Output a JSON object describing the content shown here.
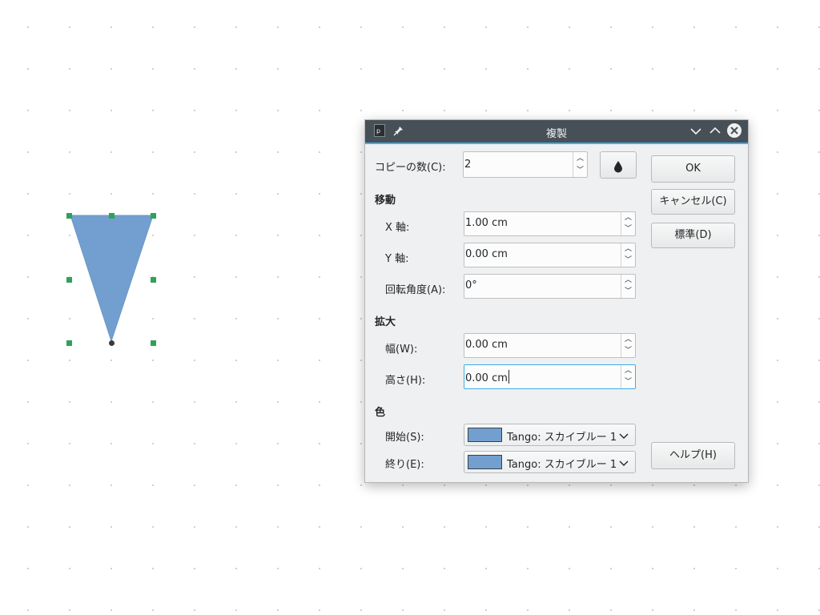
{
  "canvas": {
    "shape_fill": "#729fcf",
    "handle_color": "#2fa25a"
  },
  "dialog": {
    "title": "複製",
    "copies": {
      "label": "コピーの数(C):",
      "value": "2"
    },
    "sections": {
      "move": "移動",
      "enlarge": "拡大",
      "color": "色"
    },
    "x_axis": {
      "label": "X 軸:",
      "value": "1.00 cm"
    },
    "y_axis": {
      "label": "Y 軸:",
      "value": "0.00 cm"
    },
    "rotation": {
      "label": "回転角度(A):",
      "value": "0°"
    },
    "width": {
      "label": "幅(W):",
      "value": "0.00 cm"
    },
    "height": {
      "label": "高さ(H):",
      "value": "0.00 cm"
    },
    "start_color": {
      "label": "開始(S):",
      "value": "Tango: スカイブルー 1",
      "swatch": "#729fcf"
    },
    "end_color": {
      "label": "終り(E):",
      "value": "Tango: スカイブルー 1",
      "swatch": "#729fcf"
    },
    "buttons": {
      "ok": "OK",
      "cancel": "キャンセル(C)",
      "default": "標準(D)",
      "help": "ヘルプ(H)"
    },
    "accent": "#3daee9",
    "titlebar_bg": "#475057"
  }
}
